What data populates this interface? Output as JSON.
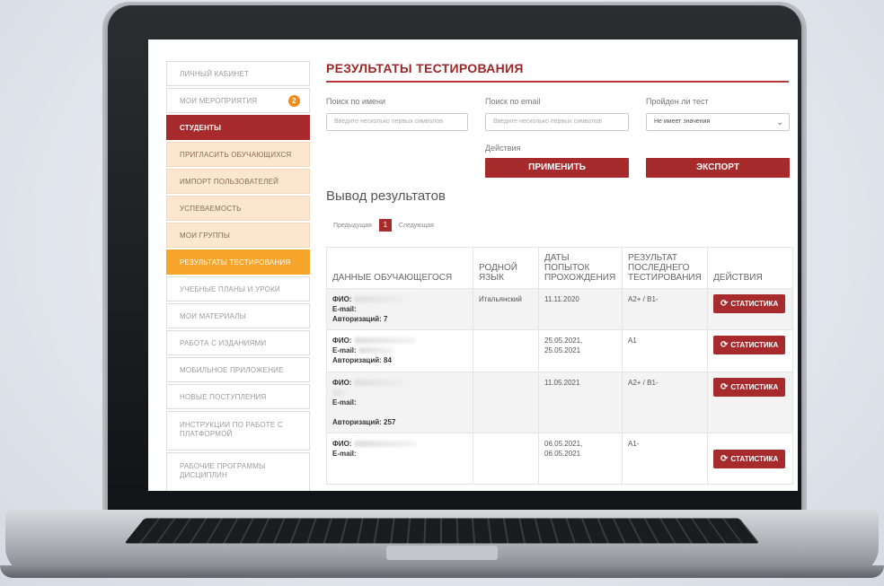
{
  "sidebar": {
    "items": [
      {
        "label": "Личный кабинет"
      },
      {
        "label": "Мои мероприятия",
        "badge": "2"
      },
      {
        "label": "Студенты"
      },
      {
        "label": "Пригласить обучающихся"
      },
      {
        "label": "Импорт пользователей"
      },
      {
        "label": "Успеваемость"
      },
      {
        "label": "Мои группы"
      },
      {
        "label": "Результаты тестирования"
      },
      {
        "label": "Учебные планы и уроки"
      },
      {
        "label": "Мои материалы"
      },
      {
        "label": "Работа с изданиями"
      },
      {
        "label": "Мобильное приложение"
      },
      {
        "label": "Новые поступления"
      },
      {
        "label": "Инструкции по работе с платформой"
      },
      {
        "label": "Рабочие программы дисциплин"
      }
    ]
  },
  "main": {
    "title": "Результаты тестирования",
    "filters": {
      "name_label": "Поиск по имени",
      "name_placeholder": "Введите несколько первых символов",
      "email_label": "Поиск по email",
      "email_placeholder": "Введите несколько первых символов",
      "passed_label": "Пройден ли тест",
      "passed_value": "Не имеет значения",
      "actions_label": "Действия",
      "apply_button": "Применить",
      "export_button": "Экспорт"
    },
    "results_title": "Вывод результатов",
    "pager": {
      "prev": "Предыдущая",
      "current": "1",
      "next": "Следующая"
    },
    "table": {
      "headers": [
        "Данные обучающегося",
        "Родной язык",
        "Даты попыток прохождения",
        "Результат последнего тестирования",
        "Действия"
      ],
      "rows": [
        {
          "fio": "ФИО:",
          "email": "E-mail:",
          "auth": "Авторизаций: 7",
          "language": "Итальянский",
          "dates": "11.11.2020",
          "result": "A2+ / B1-",
          "action": "Статистика"
        },
        {
          "fio": "ФИО:",
          "email": "E-mail:",
          "auth": "Авторизаций: 84",
          "language": "",
          "dates": "25.05.2021, 25.05.2021",
          "result": "A1",
          "action": "Статистика"
        },
        {
          "fio": "ФИО:",
          "email": "E-mail:",
          "auth": "Авторизаций: 257",
          "language": "",
          "dates": "11.05.2021",
          "result": "A2+ / B1-",
          "action": "Статистика"
        },
        {
          "fio": "ФИО:",
          "email": "E-mail:",
          "auth": "",
          "language": "",
          "dates": "06.05.2021, 06.05.2021",
          "result": "A1-",
          "action": "Статистика"
        }
      ]
    }
  },
  "colors": {
    "accent": "#a72b2d",
    "orange": "#f7a42a",
    "sub_bg": "#fbe7d0"
  }
}
